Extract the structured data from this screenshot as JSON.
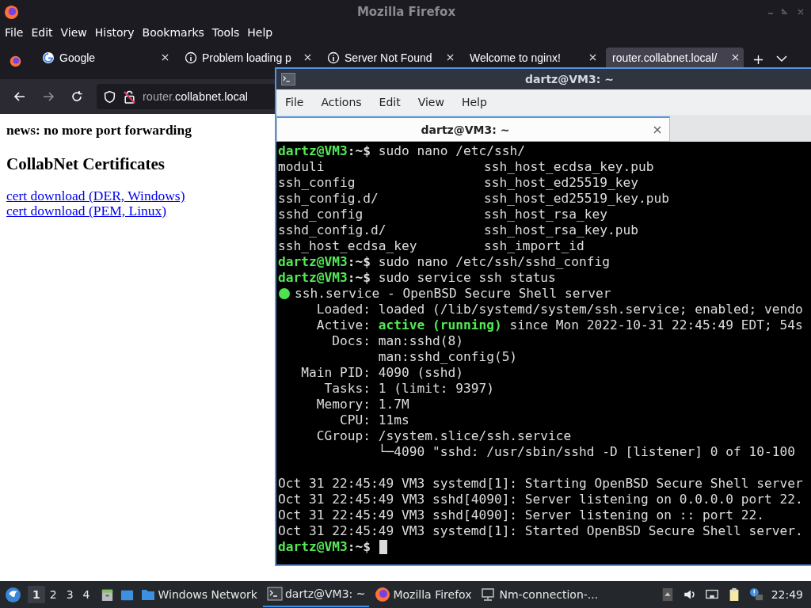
{
  "browser": {
    "title": "Mozilla Firefox",
    "menu": [
      "File",
      "Edit",
      "View",
      "History",
      "Bookmarks",
      "Tools",
      "Help"
    ],
    "tabs": [
      {
        "label": "Google",
        "kind": "site",
        "selected": false
      },
      {
        "label": "Problem loading p",
        "kind": "error",
        "selected": false
      },
      {
        "label": "Server Not Found",
        "kind": "error",
        "selected": false
      },
      {
        "label": "Welcome to nginx!",
        "kind": "plain",
        "selected": false
      },
      {
        "label": "router.collabnet.local/",
        "kind": "plain",
        "selected": true
      }
    ],
    "url": {
      "host": "router.",
      "domain": "collabnet.local"
    },
    "page": {
      "news": "news: no more port forwarding",
      "heading": "CollabNet Certificates",
      "links": [
        "cert download (DER, Windows)",
        "cert download (PEM, Linux)"
      ]
    }
  },
  "terminal": {
    "title": "dartz@VM3: ~",
    "menu": [
      "File",
      "Actions",
      "Edit",
      "View",
      "Help"
    ],
    "tab": "dartz@VM3: ~",
    "lines": [
      {
        "kind": "prompt",
        "user": "dartz@VM3",
        "path": ":~$",
        "text": " sudo nano /etc/ssh/"
      },
      {
        "kind": "columns",
        "cols": [
          "moduli",
          "ssh_host_ecdsa_key.pub"
        ]
      },
      {
        "kind": "columns",
        "cols": [
          "ssh_config",
          "ssh_host_ed25519_key"
        ]
      },
      {
        "kind": "columns",
        "cols": [
          "ssh_config.d/",
          "ssh_host_ed25519_key.pub"
        ]
      },
      {
        "kind": "columns",
        "cols": [
          "sshd_config",
          "ssh_host_rsa_key"
        ]
      },
      {
        "kind": "columns",
        "cols": [
          "sshd_config.d/",
          "ssh_host_rsa_key.pub"
        ]
      },
      {
        "kind": "columns",
        "cols": [
          "ssh_host_ecdsa_key",
          "ssh_import_id"
        ]
      },
      {
        "kind": "prompt",
        "user": "dartz@VM3",
        "path": ":~$",
        "text": " sudo nano /etc/ssh/sshd_config"
      },
      {
        "kind": "prompt",
        "user": "dartz@VM3",
        "path": ":~$",
        "text": " sudo service ssh status"
      },
      {
        "kind": "status",
        "color": "#4ee44e",
        "text": "ssh.service - OpenBSD Secure Shell server"
      },
      {
        "kind": "text",
        "text": "     Loaded: loaded (/lib/systemd/system/ssh.service; enabled; vendo"
      },
      {
        "kind": "active",
        "label": "     Active: ",
        "value": "active (running)",
        "text": " since Mon 2022-10-31 22:45:49 EDT; 54s"
      },
      {
        "kind": "text",
        "text": "       Docs: man:sshd(8)"
      },
      {
        "kind": "text",
        "text": "             man:sshd_config(5)"
      },
      {
        "kind": "text",
        "text": "   Main PID: 4090 (sshd)"
      },
      {
        "kind": "text",
        "text": "      Tasks: 1 (limit: 9397)"
      },
      {
        "kind": "text",
        "text": "     Memory: 1.7M"
      },
      {
        "kind": "text",
        "text": "        CPU: 11ms"
      },
      {
        "kind": "text",
        "text": "     CGroup: /system.slice/ssh.service"
      },
      {
        "kind": "text",
        "text": "             └─4090 \"sshd: /usr/sbin/sshd -D [listener] 0 of 10-100"
      },
      {
        "kind": "blank"
      },
      {
        "kind": "text",
        "text": "Oct 31 22:45:49 VM3 systemd[1]: Starting OpenBSD Secure Shell server"
      },
      {
        "kind": "text",
        "text": "Oct 31 22:45:49 VM3 sshd[4090]: Server listening on 0.0.0.0 port 22."
      },
      {
        "kind": "text",
        "text": "Oct 31 22:45:49 VM3 sshd[4090]: Server listening on :: port 22."
      },
      {
        "kind": "text",
        "text": "Oct 31 22:45:49 VM3 systemd[1]: Started OpenBSD Secure Shell server."
      },
      {
        "kind": "cursor",
        "user": "dartz@VM3",
        "path": ":~$"
      }
    ]
  },
  "taskbar": {
    "workspaces": [
      {
        "label": "1",
        "selected": true
      },
      {
        "label": "2",
        "selected": false
      },
      {
        "label": "3",
        "selected": false
      },
      {
        "label": "4",
        "selected": false
      }
    ],
    "tasks": [
      {
        "label": "Windows Network",
        "kind": "folder",
        "selected": false
      },
      {
        "label": "dartz@VM3: ~",
        "kind": "terminal",
        "selected": true
      },
      {
        "label": "Mozilla Firefox",
        "kind": "browser",
        "selected": false
      },
      {
        "label": "Nm-connection-...",
        "kind": "network",
        "selected": false
      }
    ],
    "clock": "22:49"
  }
}
